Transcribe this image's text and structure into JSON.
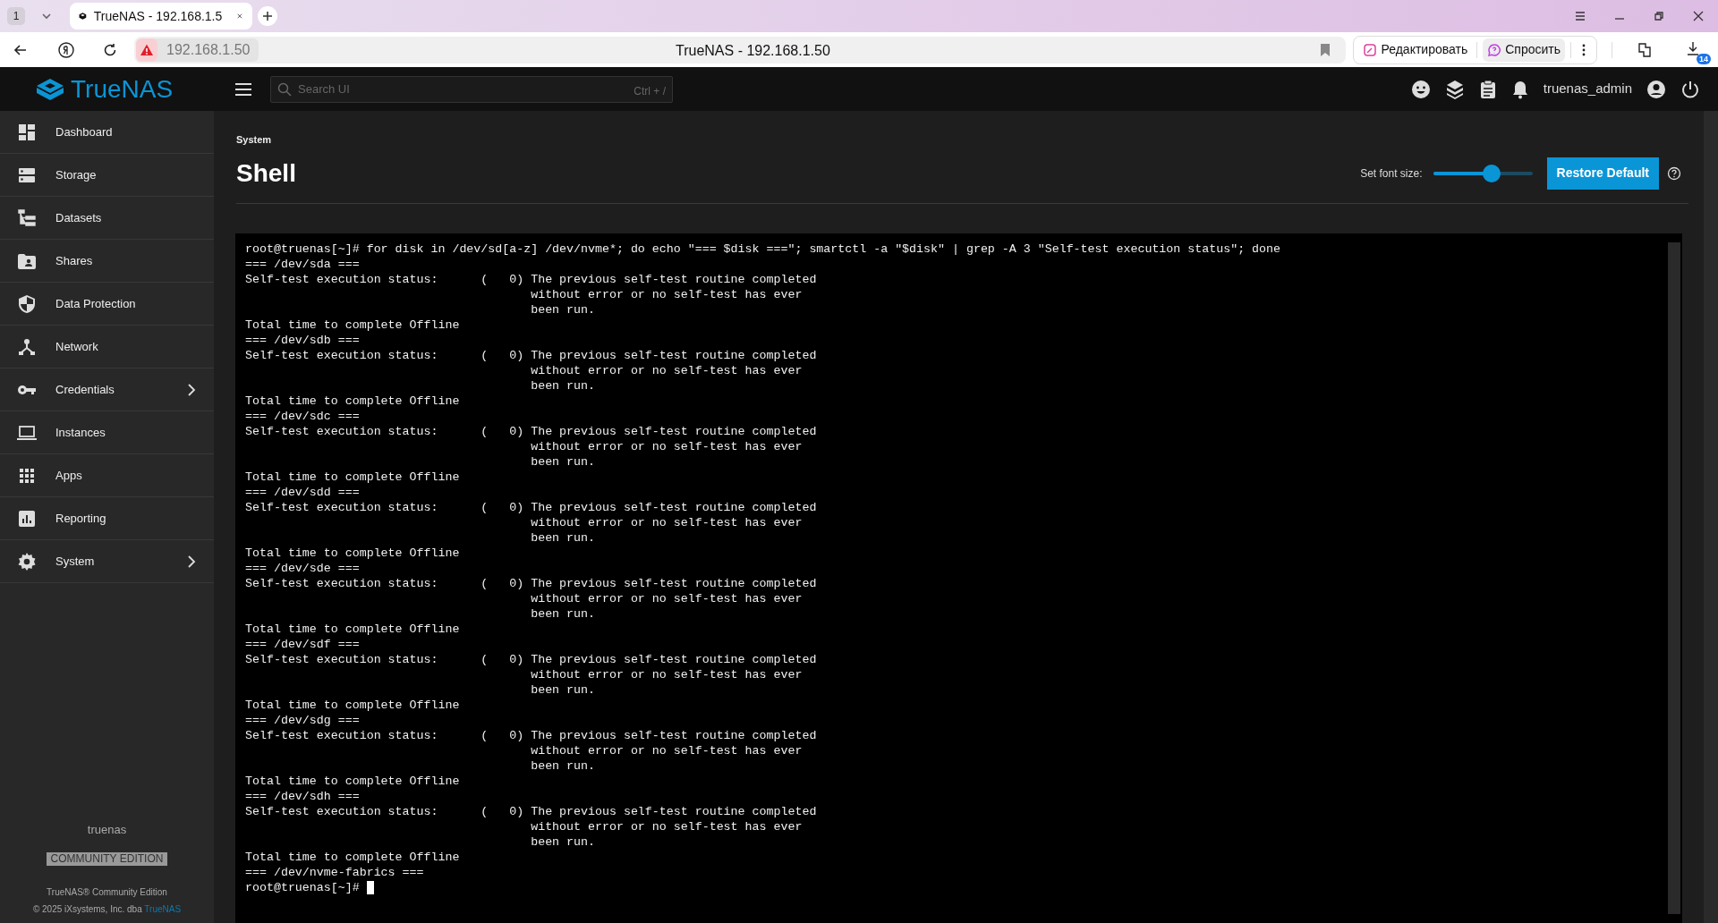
{
  "browser": {
    "tab_count": "1",
    "tab_title": "TrueNAS - 192.168.1.5",
    "address": "192.168.1.50",
    "page_title": "TrueNAS - 192.168.1.50",
    "edit_button": "Редактировать",
    "ask_button": "Спросить",
    "downloads_badge": "14"
  },
  "header": {
    "logo": "TrueNAS",
    "search": {
      "placeholder": "Search UI",
      "shortcut": "Ctrl + /"
    },
    "user": "truenas_admin"
  },
  "sidebar": {
    "items": [
      {
        "label": "Dashboard",
        "has_children": false
      },
      {
        "label": "Storage",
        "has_children": false
      },
      {
        "label": "Datasets",
        "has_children": false
      },
      {
        "label": "Shares",
        "has_children": false
      },
      {
        "label": "Data Protection",
        "has_children": false
      },
      {
        "label": "Network",
        "has_children": false
      },
      {
        "label": "Credentials",
        "has_children": true
      },
      {
        "label": "Instances",
        "has_children": false
      },
      {
        "label": "Apps",
        "has_children": false
      },
      {
        "label": "Reporting",
        "has_children": false
      },
      {
        "label": "System",
        "has_children": true
      }
    ],
    "hostname": "truenas",
    "edition_badge": "COMMUNITY EDITION",
    "product": "TrueNAS® Community Edition",
    "copyright": "© 2025 iXsystems, Inc. dba",
    "copyright_link": "TrueNAS"
  },
  "page": {
    "breadcrumb": "System",
    "title": "Shell",
    "font_size_label": "Set font size:",
    "font_size": {
      "level": 0.59
    },
    "restore_button": "Restore Default"
  },
  "terminal": {
    "command": "root@truenas[~]# for disk in /dev/sd[a-z] /dev/nvme*; do echo \"=== $disk ===\"; smartctl -a \"$disk\" | grep -A 3 \"Self-test execution status\"; done",
    "disks": [
      {
        "header": "=== /dev/sda ===",
        "status": [
          "Self-test execution status:      (   0) The previous self-test routine completed",
          "without error or no self-test has ever",
          "been run."
        ],
        "total": "Total time to complete Offline"
      },
      {
        "header": "=== /dev/sdb ===",
        "status": [
          "Self-test execution status:      (   0) The previous self-test routine completed",
          "without error or no self-test has ever",
          "been run."
        ],
        "total": "Total time to complete Offline"
      },
      {
        "header": "=== /dev/sdc ===",
        "status": [
          "Self-test execution status:      (   0) The previous self-test routine completed",
          "without error or no self-test has ever",
          "been run."
        ],
        "total": "Total time to complete Offline"
      },
      {
        "header": "=== /dev/sdd ===",
        "status": [
          "Self-test execution status:      (   0) The previous self-test routine completed",
          "without error or no self-test has ever",
          "been run."
        ],
        "total": "Total time to complete Offline"
      },
      {
        "header": "=== /dev/sde ===",
        "status": [
          "Self-test execution status:      (   0) The previous self-test routine completed",
          "without error or no self-test has ever",
          "been run."
        ],
        "total": "Total time to complete Offline"
      },
      {
        "header": "=== /dev/sdf ===",
        "status": [
          "Self-test execution status:      (   0) The previous self-test routine completed",
          "without error or no self-test has ever",
          "been run."
        ],
        "total": "Total time to complete Offline"
      },
      {
        "header": "=== /dev/sdg ===",
        "status": [
          "Self-test execution status:      (   0) The previous self-test routine completed",
          "without error or no self-test has ever",
          "been run."
        ],
        "total": "Total time to complete Offline"
      },
      {
        "header": "=== /dev/sdh ===",
        "status": [
          "Self-test execution status:      (   0) The previous self-test routine completed",
          "without error or no self-test has ever",
          "been run."
        ],
        "total": "Total time to complete Offline"
      },
      {
        "header": "=== /dev/nvme-fabrics ==="
      }
    ],
    "prompt": "root@truenas[~]#"
  }
}
